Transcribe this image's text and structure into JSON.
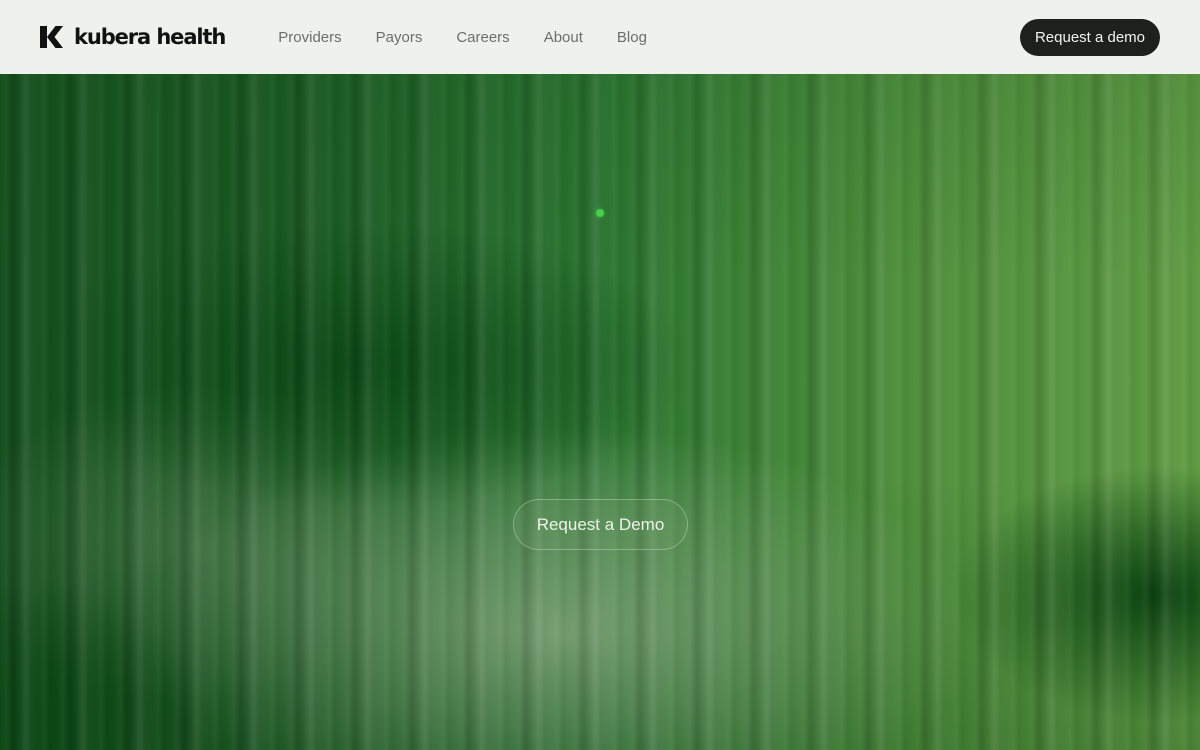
{
  "header": {
    "logo_text": "kubera health",
    "logo_icon": "kubera-k-icon",
    "nav": [
      {
        "label": "Providers"
      },
      {
        "label": "Payors"
      },
      {
        "label": "Careers"
      },
      {
        "label": "About"
      },
      {
        "label": "Blog"
      }
    ],
    "cta_label": "Request a demo"
  },
  "hero": {
    "cta_label": "Request a Demo",
    "indicator_icon": "green-dot-icon"
  },
  "colors": {
    "header_bg": "#eef1ec",
    "header_button_bg": "#1d211e",
    "hero_green_dark": "#134f1c",
    "hero_green_light": "#5f9c42",
    "accent_dot": "#43d14a"
  }
}
